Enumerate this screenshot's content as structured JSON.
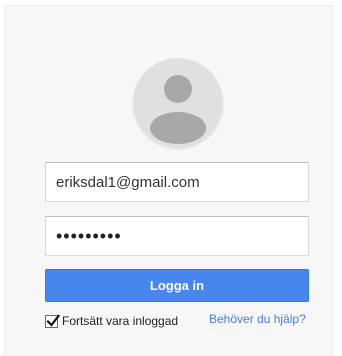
{
  "login": {
    "email_value": "eriksdal1@gmail.com",
    "password_mask": "•••••••••",
    "signin_label": "Logga in",
    "remember_label": "Fortsätt vara inloggad",
    "remember_checked": true,
    "help_link": "Behöver du hjälp?"
  },
  "icons": {
    "avatar": "default-user-avatar-icon",
    "checkmark": "checkmark-icon"
  },
  "colors": {
    "button": "#4787ed",
    "link": "#427fed",
    "card_background": "#f7f7f7"
  }
}
